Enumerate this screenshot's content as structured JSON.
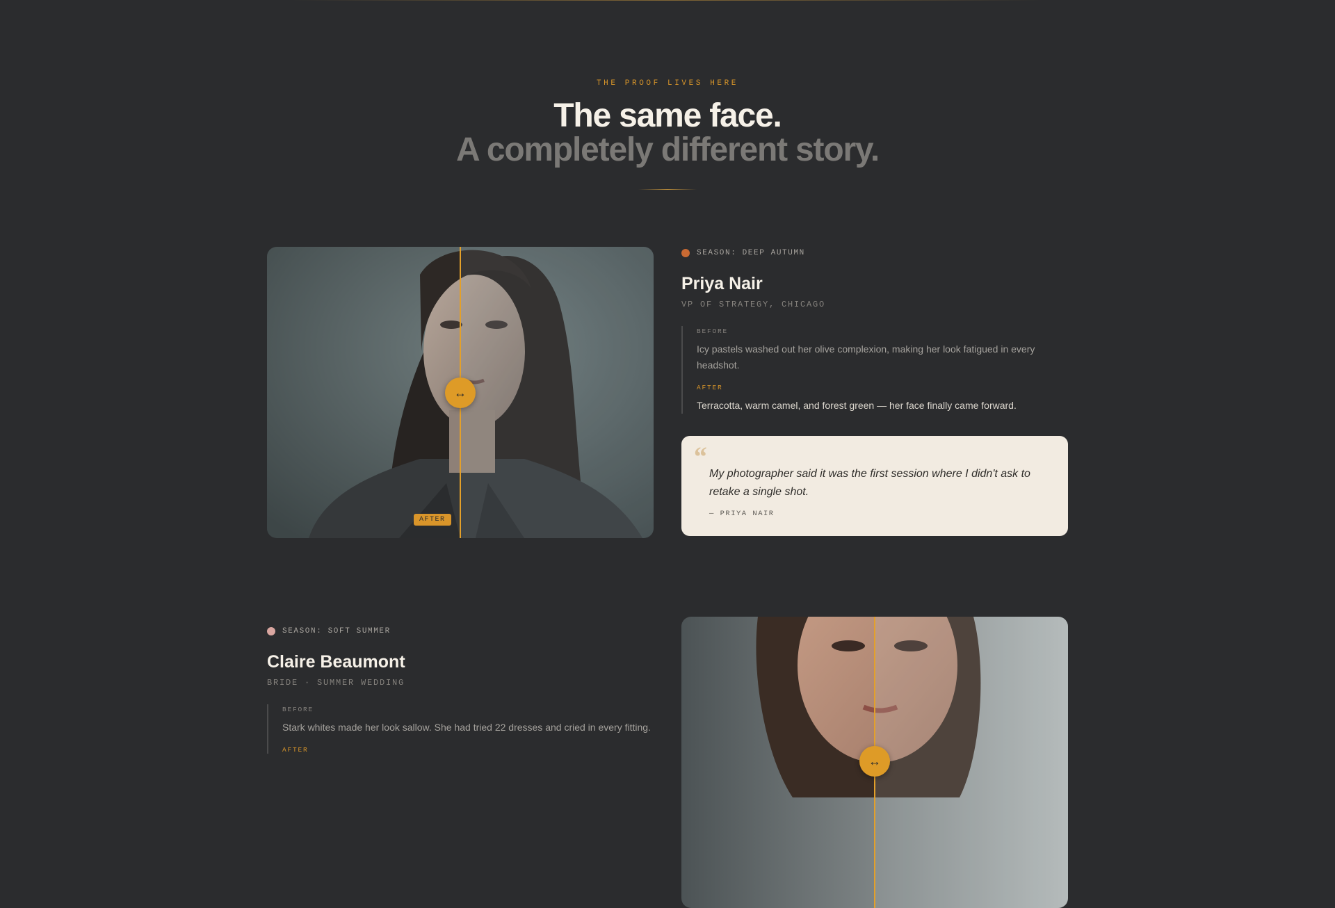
{
  "header": {
    "eyebrow": "THE PROOF LIVES HERE",
    "title_line1": "The same face.",
    "title_line2": "A completely different story."
  },
  "cases": [
    {
      "season_label": "SEASON: DEEP AUTUMN",
      "season_color": "#c96a33",
      "name": "Priya Nair",
      "role": "VP OF STRATEGY, CHICAGO",
      "before_label": "BEFORE",
      "before_text": "Icy pastels washed out her olive complexion, making her look fatigued in every headshot.",
      "after_label": "AFTER",
      "after_text": "Terracotta, warm camel, and forest green — her face finally came forward.",
      "quote": "My photographer said it was the first session where I didn't ask to retake a single shot.",
      "quote_author": "— PRIYA NAIR",
      "image_badge": "AFTER",
      "handle_glyph": "↔"
    },
    {
      "season_label": "SEASON: SOFT SUMMER",
      "season_color": "#d9a6a0",
      "name": "Claire Beaumont",
      "role": "BRIDE · SUMMER WEDDING",
      "before_label": "BEFORE",
      "before_text": "Stark whites made her look sallow. She had tried 22 dresses and cried in every fitting.",
      "after_label": "AFTER"
    }
  ],
  "colors": {
    "accent": "#de9b27",
    "background": "#2b2c2e",
    "quote_card": "#f2ebe1"
  }
}
